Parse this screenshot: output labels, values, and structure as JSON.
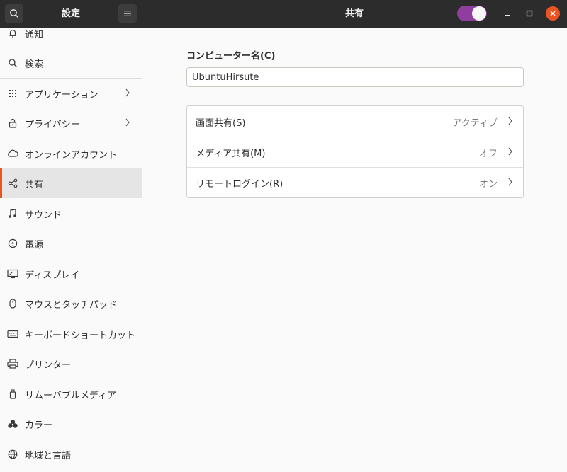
{
  "headerbar": {
    "sidebar_title": "設定",
    "main_title": "共有",
    "sharing_toggle_on": true,
    "accent_color": "#8f3e9f",
    "close_color": "#e95420"
  },
  "sidebar": {
    "items": [
      {
        "label": "通知",
        "icon": "bell-icon"
      },
      {
        "label": "検索",
        "icon": "search-icon"
      },
      {
        "label": "アプリケーション",
        "icon": "apps-grid-icon"
      },
      {
        "label": "プライバシー",
        "icon": "lock-icon"
      },
      {
        "label": "オンラインアカウント",
        "icon": "cloud-icon"
      },
      {
        "label": "共有",
        "icon": "share-icon"
      },
      {
        "label": "サウンド",
        "icon": "music-note-icon"
      },
      {
        "label": "電源",
        "icon": "power-icon"
      },
      {
        "label": "ディスプレイ",
        "icon": "display-icon"
      },
      {
        "label": "マウスとタッチパッド",
        "icon": "mouse-icon"
      },
      {
        "label": "キーボードショートカット",
        "icon": "keyboard-icon"
      },
      {
        "label": "プリンター",
        "icon": "printer-icon"
      },
      {
        "label": "リムーバブルメディア",
        "icon": "removable-media-icon"
      },
      {
        "label": "カラー",
        "icon": "color-icon"
      },
      {
        "label": "地域と言語",
        "icon": "globe-icon"
      }
    ],
    "active_label": "共有",
    "active_color": "#e95420"
  },
  "main": {
    "computer_name_label": "コンピューター名(C)",
    "computer_name_value": "UbuntuHirsute",
    "rows": [
      {
        "label": "画面共有(S)",
        "status": "アクティブ"
      },
      {
        "label": "メディア共有(M)",
        "status": "オフ"
      },
      {
        "label": "リモートログイン(R)",
        "status": "オン"
      }
    ]
  }
}
